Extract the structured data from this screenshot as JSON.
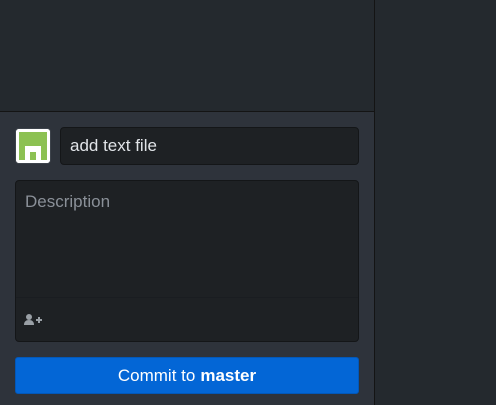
{
  "commit": {
    "summary_value": "add text file",
    "description_placeholder": "Description",
    "button_prefix": "Commit to",
    "branch": "master"
  },
  "colors": {
    "accent": "#0366d6",
    "background": "#24292e",
    "panel": "#2e333b",
    "input": "#1e2124",
    "avatar_green": "#8cc152"
  },
  "icons": {
    "avatar": "identicon-avatar",
    "coauthor": "add-coauthor-icon"
  }
}
